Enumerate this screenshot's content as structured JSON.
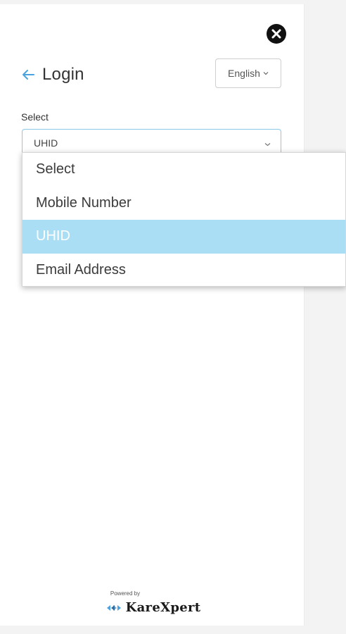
{
  "header": {
    "title": "Login",
    "language": "English"
  },
  "form": {
    "label": "Select",
    "selected_value": "UHID"
  },
  "dropdown": {
    "options": [
      "Select",
      "Mobile Number",
      "UHID",
      "Email Address"
    ],
    "selected_index": 2
  },
  "footer": {
    "powered_by": "Powered by",
    "brand": "KareXpert"
  },
  "colors": {
    "accent": "#4aa3df",
    "selected_option_bg": "#a9def4",
    "select_border": "#8cc8ea"
  }
}
